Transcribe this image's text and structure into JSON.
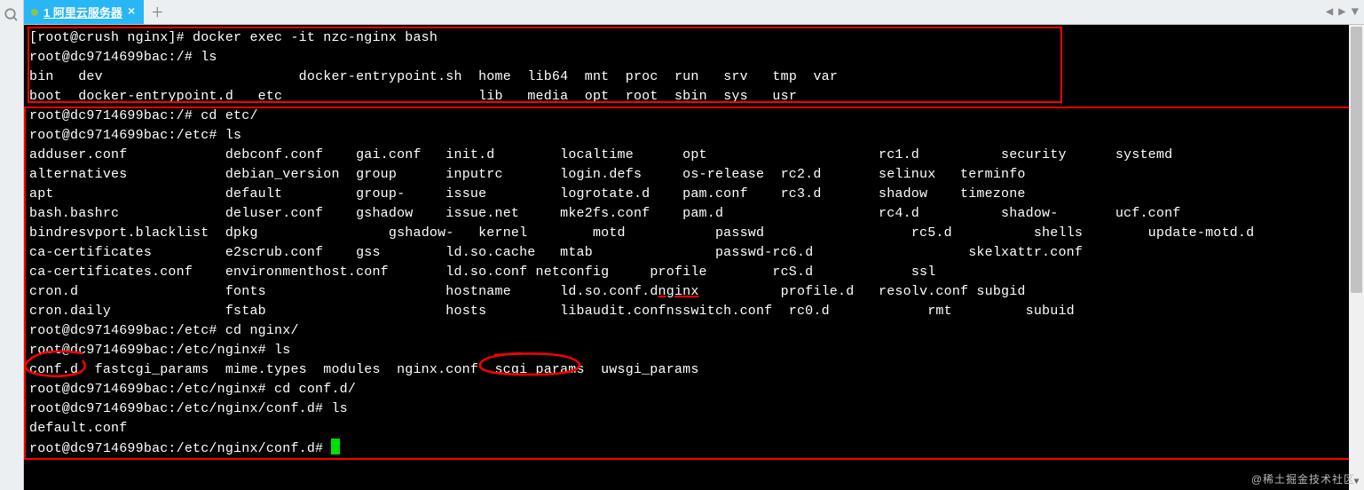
{
  "tab": {
    "index": "1",
    "title": "阿里云服务器"
  },
  "watermark": "@稀土掘金技术社区",
  "term": {
    "lines": [
      {
        "t": "cmd",
        "prompt": "[root@crush nginx]# ",
        "cmd": "docker exec -it nzc-nginx bash"
      },
      {
        "t": "cmd",
        "prompt": "root@dc9714699bac:/# ",
        "cmd": "ls"
      },
      {
        "t": "cols",
        "cols": [
          "bin",
          "dev",
          "",
          "docker-entrypoint.sh",
          "home",
          "lib64",
          "mnt",
          "proc",
          "run",
          "srv",
          "tmp",
          "var"
        ]
      },
      {
        "t": "cols",
        "cols": [
          "boot",
          "docker-entrypoint.d",
          "etc",
          "",
          "lib",
          "media",
          "opt",
          "root",
          "sbin",
          "sys",
          "usr",
          ""
        ]
      },
      {
        "t": "cmd",
        "prompt": "root@dc9714699bac:/# ",
        "cmd": "cd etc/"
      },
      {
        "t": "cmd",
        "prompt": "root@dc9714699bac:/etc# ",
        "cmd": "ls"
      },
      {
        "t": "cols",
        "cols": [
          "adduser.conf",
          "",
          "debconf.conf",
          "gai.conf",
          "init.d",
          "",
          "localtime",
          "",
          "opt",
          "",
          "rc1.d",
          "",
          "security",
          "systemd"
        ]
      },
      {
        "t": "cols",
        "cols": [
          "alternatives",
          "",
          "debian_version",
          "group",
          "inputrc",
          "",
          "login.defs",
          "",
          "os-release",
          "rc2.d",
          "",
          "selinux",
          "terminfo"
        ]
      },
      {
        "t": "cols",
        "cols": [
          "apt",
          "",
          "default",
          "group-",
          "issue",
          "",
          "logrotate.d",
          "",
          "pam.conf",
          "rc3.d",
          "",
          "shadow",
          "timezone"
        ]
      },
      {
        "t": "cols",
        "cols": [
          "bash.bashrc",
          "",
          "deluser.conf",
          "gshadow",
          "issue.net",
          "",
          "mke2fs.conf",
          "",
          "pam.d",
          "",
          "rc4.d",
          "",
          "shadow-",
          "ucf.conf"
        ]
      },
      {
        "t": "cols",
        "cols": [
          "bindresvport.blacklist",
          "dpkg",
          "",
          "gshadow-",
          "kernel",
          "",
          "motd",
          "",
          "passwd",
          "",
          "rc5.d",
          "",
          "shells",
          "update-motd.d"
        ]
      },
      {
        "t": "cols",
        "cols": [
          "ca-certificates",
          "",
          "e2scrub.conf",
          "gss",
          "ld.so.cache",
          "mtab",
          "",
          "passwd-",
          "rc6.d",
          "",
          "skel",
          "xattr.conf"
        ]
      },
      {
        "t": "cols",
        "cols": [
          "ca-certificates.conf",
          "environment",
          "host.conf",
          "ld.so.conf",
          "netconfig",
          "",
          "profile",
          "rcS.d",
          "",
          "ssl",
          ""
        ]
      },
      {
        "t": "cols",
        "cols": [
          "cron.d",
          "",
          "fonts",
          "",
          "hostname",
          "ld.so.conf.d",
          "nginx",
          "",
          "profile.d",
          "resolv.conf",
          "subgid",
          ""
        ],
        "hl": {
          "6": true
        }
      },
      {
        "t": "cols",
        "cols": [
          "cron.daily",
          "",
          "fstab",
          "",
          "hosts",
          "libaudit.conf",
          "nsswitch.conf",
          "rc0.d",
          "",
          "rmt",
          "",
          "subuid",
          ""
        ]
      },
      {
        "t": "cmd",
        "prompt": "root@dc9714699bac:/etc# ",
        "cmd": "cd nginx/"
      },
      {
        "t": "cmd",
        "prompt": "root@dc9714699bac:/etc/nginx# ",
        "cmd": "ls"
      },
      {
        "t": "plain",
        "text": "conf.d  fastcgi_params  mime.types  modules  nginx.conf  scgi_params  uwsgi_params"
      },
      {
        "t": "cmd",
        "prompt": "root@dc9714699bac:/etc/nginx# ",
        "cmd": "cd conf.d/"
      },
      {
        "t": "cmd",
        "prompt": "root@dc9714699bac:/etc/nginx/conf.d# ",
        "cmd": "ls"
      },
      {
        "t": "plain",
        "text": "default.conf"
      },
      {
        "t": "cmd",
        "prompt": "root@dc9714699bac:/etc/nginx/conf.d# ",
        "cmd": "",
        "cursor": true
      }
    ]
  }
}
